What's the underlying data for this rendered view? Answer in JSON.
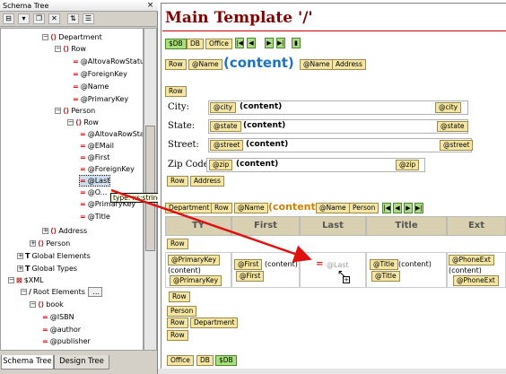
{
  "left_panel": {
    "title": "Schema Tree",
    "close": "×",
    "tabs": [
      "Schema Tree",
      "Design Tree"
    ],
    "tree": [
      {
        "text": "Department",
        "kind": "elem",
        "sign": "⊟"
      },
      {
        "text": "Row",
        "kind": "elem",
        "sign": "⊟"
      },
      {
        "text": "@AltovaRowStatus",
        "kind": "attr"
      },
      {
        "text": "@ForeignKey",
        "kind": "attr"
      },
      {
        "text": "@Name",
        "kind": "attr"
      },
      {
        "text": "@PrimaryKey",
        "kind": "attr"
      },
      {
        "text": "Person",
        "kind": "elem",
        "sign": "⊟"
      },
      {
        "text": "Row",
        "kind": "elem",
        "sign": "⊟"
      },
      {
        "text": "@AltovaRowStat",
        "kind": "attr"
      },
      {
        "text": "@EMail",
        "kind": "attr"
      },
      {
        "text": "@First",
        "kind": "attr"
      },
      {
        "text": "@ForeignKey",
        "kind": "attr"
      },
      {
        "text": "@Last",
        "kind": "attr"
      },
      {
        "text": "@O...",
        "kind": "attr"
      },
      {
        "text": "@PrimaryKey",
        "kind": "attr"
      },
      {
        "text": "@Title",
        "kind": "attr"
      },
      {
        "text": "Address",
        "kind": "elem",
        "sign": "⊞"
      },
      {
        "text": "Person",
        "kind": "elem",
        "sign": "⊞"
      },
      {
        "text": "Global Elements",
        "kind": "global",
        "sign": "⊞"
      },
      {
        "text": "Global Types",
        "kind": "global",
        "sign": "⊞"
      },
      {
        "text": "$XML",
        "kind": "xml",
        "sign": "⊟"
      },
      {
        "text": "Root Elements",
        "kind": "root",
        "sign": "⊟"
      },
      {
        "text": "book",
        "kind": "elem",
        "sign": "⊟"
      },
      {
        "text": "@ISBN",
        "kind": "attr"
      },
      {
        "text": "@author",
        "kind": "attr"
      },
      {
        "text": "@publisher",
        "kind": "attr"
      }
    ],
    "tooltip": "type: xs:string (simpleType)",
    "root_more": "..."
  },
  "design": {
    "title": "Main Template '/'",
    "top_tags": [
      "$DB",
      "DB",
      "Office"
    ],
    "nav_buttons": [
      "|◀",
      "◀",
      "▶",
      "▶|",
      "▮"
    ],
    "row_tags": [
      "Row",
      "@Name",
      "@Name",
      "Address"
    ],
    "content": "(content)",
    "row_tag2": "Row",
    "address_fields": [
      {
        "label": "City:",
        "attr": "@city",
        "value": "(content)"
      },
      {
        "label": "State:",
        "attr": "@state",
        "value": "(content)"
      },
      {
        "label": "Street:",
        "attr": "@street",
        "value": "(content)"
      },
      {
        "label": "Zip Code:",
        "attr": "@zip",
        "value": "(content)"
      }
    ],
    "end_tags1": [
      "Row",
      "Address"
    ],
    "dept_tags": [
      "Department",
      "Row",
      "@Name",
      "@Name",
      "Person"
    ],
    "dept_content": "(content)",
    "table_headers": [
      "TY",
      "First",
      "Last",
      "Title",
      "Ext"
    ],
    "table_row_tag": "Row",
    "cells": {
      "primary_start": "@PrimaryKey",
      "primary_content": "(content)",
      "primary_end": "@PrimaryKey",
      "first_start": "@First",
      "first_content": "(content)",
      "first_end": "@First",
      "last_drop": "=",
      "last_ghost": "@Last",
      "title_start": "@Title",
      "title_content": "(content)",
      "title_end": "@Title",
      "phone_start": "@PhoneExt",
      "phone_content": "(content)",
      "phone_end": "@PhoneExt"
    },
    "closing_tags": [
      "Row",
      "Person",
      "Row",
      "Department",
      "Row"
    ],
    "bottom_tags": [
      "Office",
      "DB",
      "$DB"
    ]
  },
  "colors": {
    "title": "#800000",
    "content_blue": "#1e73be",
    "content_orange": "#d08000",
    "arrow": "#e01010"
  }
}
